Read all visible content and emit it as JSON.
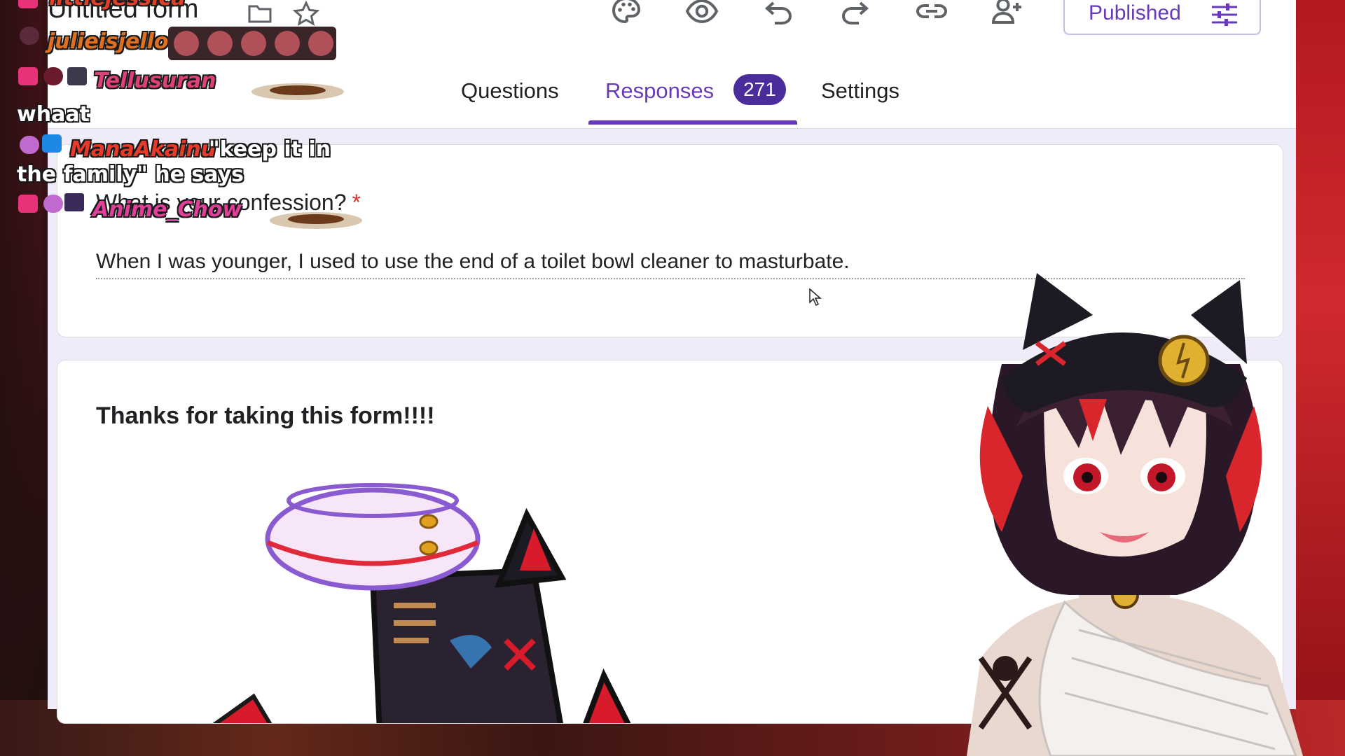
{
  "form": {
    "title": "Untitled form",
    "status_button": "Published",
    "tabs": [
      {
        "label": "Questions"
      },
      {
        "label": "Responses",
        "badge": "271"
      },
      {
        "label": "Settings"
      }
    ],
    "active_tab": "Responses",
    "toolbar_icons": [
      "palette-icon",
      "preview-eye-icon",
      "undo-icon",
      "redo-icon",
      "link-icon",
      "add-collaborator-icon"
    ],
    "question": {
      "title": "What is your confession?",
      "required_mark": "*",
      "answer": "When I was younger, I used to use the end of a toilet bowl cleaner to masturbate."
    },
    "closing_card": {
      "title": "Thanks for taking this form!!!!"
    }
  },
  "chat": {
    "messages": [
      {
        "user": "littlejessica",
        "text": ""
      },
      {
        "user": "julieisjello",
        "text": ""
      },
      {
        "user": "Tellusuran",
        "text": "whaat"
      },
      {
        "user": "ManaAkainu",
        "text": "\"keep it in the family\" he says"
      },
      {
        "user": "Anime_Chow",
        "text": ""
      }
    ],
    "colors": {
      "littlejessica": "#e0402a",
      "julieisjello": "#e07020",
      "Tellusuran": "#e0407a",
      "ManaAkainu": "#e83a2a",
      "Anime_Chow": "#e0409a"
    }
  },
  "colors": {
    "accent": "#673ab7",
    "badge": "#4a2c9a",
    "required": "#d93025",
    "form_bg": "#f0ebf8"
  }
}
